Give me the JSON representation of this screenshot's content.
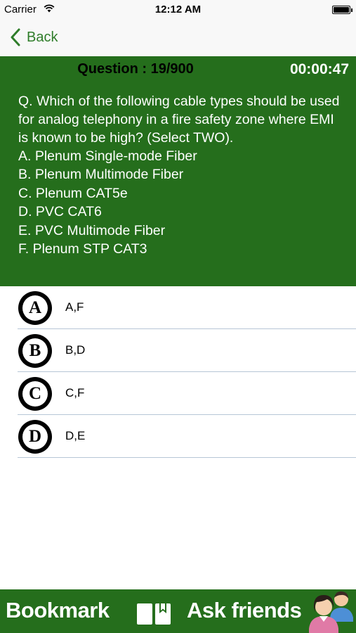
{
  "status_bar": {
    "carrier": "Carrier",
    "time": "12:12 AM",
    "battery_level": 1.0
  },
  "nav": {
    "back_label": "Back"
  },
  "question": {
    "counter": "Question : 19/900",
    "timer": "00:00:47",
    "text": "Q. Which of the following cable types should be used for analog telephony in a fire safety zone where EMI is known to be high? (Select TWO).",
    "options": [
      "A. Plenum Single-mode Fiber",
      "B. Plenum Multimode Fiber",
      "C. Plenum CAT5e",
      "D. PVC CAT6",
      "E. PVC Multimode Fiber",
      "F. Plenum STP CAT3"
    ]
  },
  "answers": [
    {
      "letter": "A",
      "label": "A,F"
    },
    {
      "letter": "B",
      "label": "B,D"
    },
    {
      "letter": "C",
      "label": "C,F"
    },
    {
      "letter": "D",
      "label": "D,E"
    }
  ],
  "bottom_bar": {
    "bookmark_label": "Bookmark",
    "ask_label": "Ask friends"
  },
  "colors": {
    "primary_green": "#256e1c",
    "back_green": "#2f7d2a",
    "divider": "#b7c6d6"
  }
}
